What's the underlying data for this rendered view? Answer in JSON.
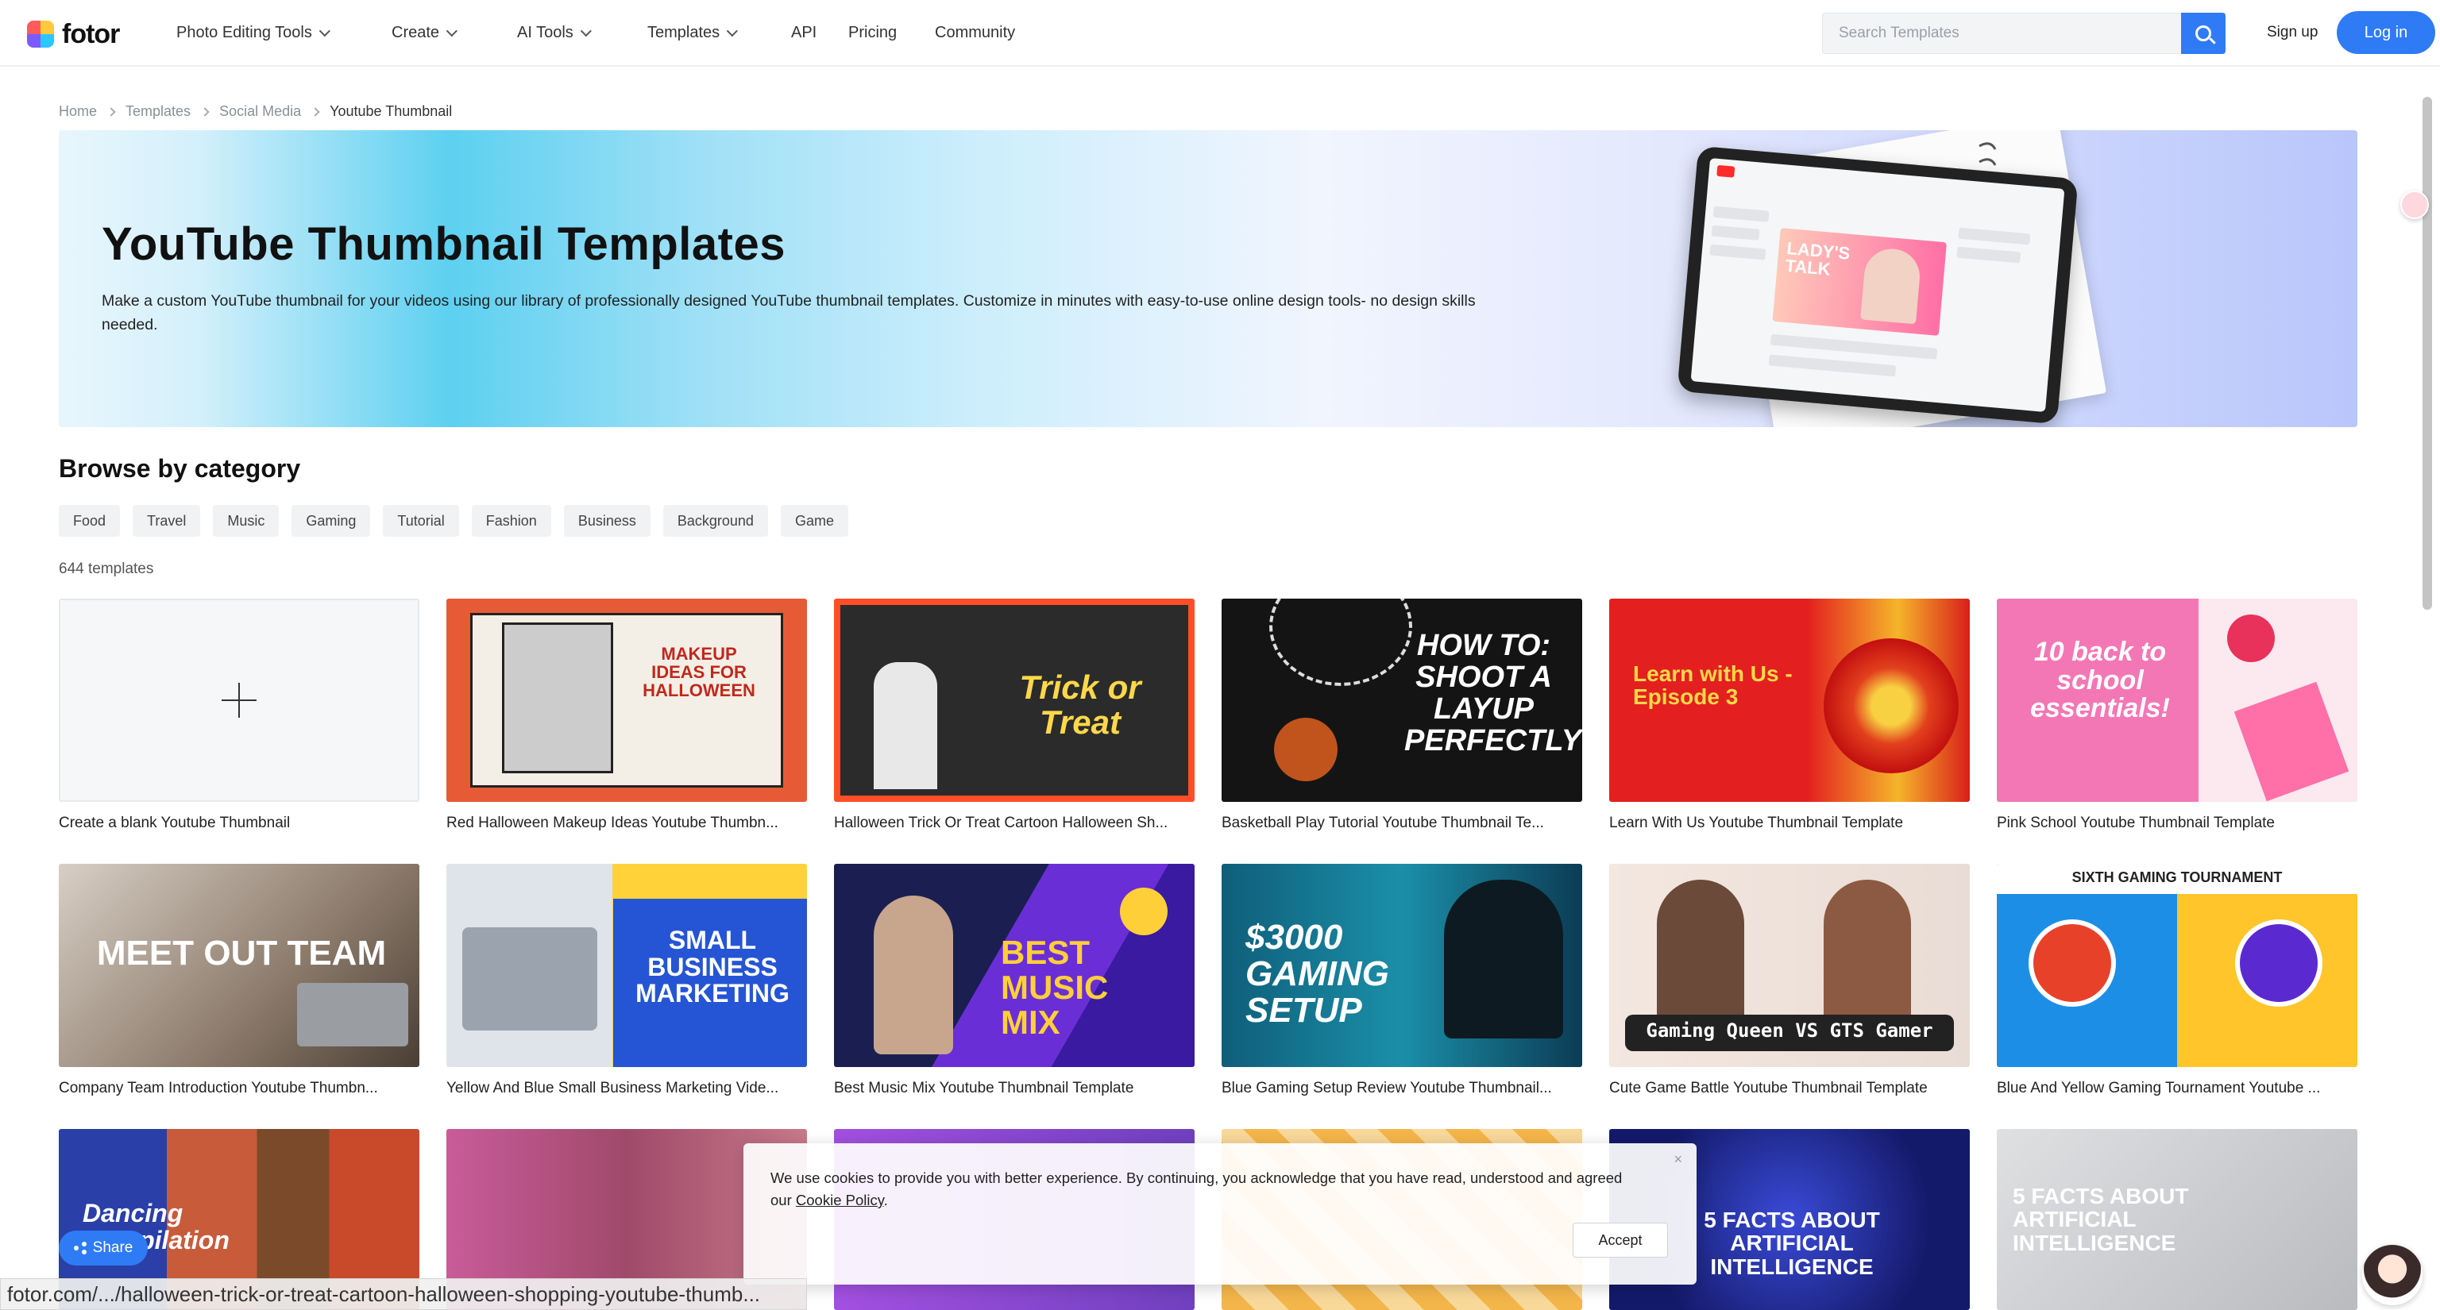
{
  "brand": {
    "name": "fotor"
  },
  "nav": {
    "items": [
      {
        "label": "Photo Editing Tools",
        "dropdown": true
      },
      {
        "label": "Create",
        "dropdown": true
      },
      {
        "label": "AI Tools",
        "dropdown": true
      },
      {
        "label": "Templates",
        "dropdown": true
      },
      {
        "label": "API",
        "dropdown": false
      },
      {
        "label": "Pricing",
        "dropdown": false
      },
      {
        "label": "Community",
        "dropdown": false
      }
    ],
    "search_placeholder": "Search Templates",
    "signup": "Sign up",
    "login": "Log in"
  },
  "breadcrumb": [
    "Home",
    "Templates",
    "Social Media",
    "Youtube Thumbnail"
  ],
  "hero": {
    "title": "YouTube Thumbnail Templates",
    "description": "Make a custom YouTube thumbnail for your videos using our library of professionally designed YouTube thumbnail templates. Customize in minutes with easy-to-use online design tools- no design skills needed.",
    "tablet_text": "LADY'S TALK"
  },
  "browse": {
    "title": "Browse by category",
    "categories": [
      "Food",
      "Travel",
      "Music",
      "Gaming",
      "Tutorial",
      "Fashion",
      "Business",
      "Background",
      "Game"
    ],
    "count": "644 templates"
  },
  "templates": [
    {
      "label": "Create a blank Youtube Thumbnail",
      "art": ""
    },
    {
      "label": "Red Halloween Makeup Ideas Youtube Thumbn...",
      "art": "MAKEUP IDEAS FOR HALLOWEEN"
    },
    {
      "label": "Halloween Trick Or Treat Cartoon Halloween Sh...",
      "art": "Trick or Treat"
    },
    {
      "label": "Basketball Play Tutorial Youtube Thumbnail Te...",
      "art": "HOW TO: SHOOT A LAYUP PERFECTLY!"
    },
    {
      "label": "Learn With Us Youtube Thumbnail Template",
      "art": "Learn with Us - Episode 3"
    },
    {
      "label": "Pink School Youtube Thumbnail Template",
      "art": "10 back to school essentials!"
    },
    {
      "label": "Company Team Introduction Youtube Thumbn...",
      "art": "MEET OUT TEAM"
    },
    {
      "label": "Yellow And Blue Small Business Marketing Vide...",
      "art": "SMALL BUSINESS MARKETING"
    },
    {
      "label": "Best Music Mix Youtube Thumbnail Template",
      "art": "BEST MUSIC MIX"
    },
    {
      "label": "Blue Gaming Setup Review Youtube Thumbnail...",
      "art": "$3000 GAMING SETUP"
    },
    {
      "label": "Cute Game Battle Youtube Thumbnail Template",
      "art": "Gaming Queen VS GTS Gamer"
    },
    {
      "label": "Blue And Yellow Gaming Tournament Youtube ...",
      "art": "SIXTH GAMING TOURNAMENT"
    },
    {
      "label": "",
      "art": "Dancing Compilation"
    },
    {
      "label": "",
      "art": ""
    },
    {
      "label": "",
      "art": ""
    },
    {
      "label": "",
      "art": ""
    },
    {
      "label": "",
      "art": "5 FACTS ABOUT ARTIFICIAL INTELLIGENCE"
    },
    {
      "label": "",
      "art": "5 FACTS ABOUT ARTIFICIAL INTELLIGENCE"
    }
  ],
  "cookie": {
    "text": "We use cookies to provide you with better experience. By continuing, you acknowledge that you have read, understood and agreed our ",
    "link": "Cookie Policy",
    "period": ".",
    "accept": "Accept",
    "close": "×"
  },
  "share": {
    "label": "Share"
  },
  "statusbar": {
    "url": "fotor.com/.../halloween-trick-or-treat-cartoon-halloween-shopping-youtube-thumb..."
  },
  "colors": {
    "accent": "#2f7bf5"
  }
}
